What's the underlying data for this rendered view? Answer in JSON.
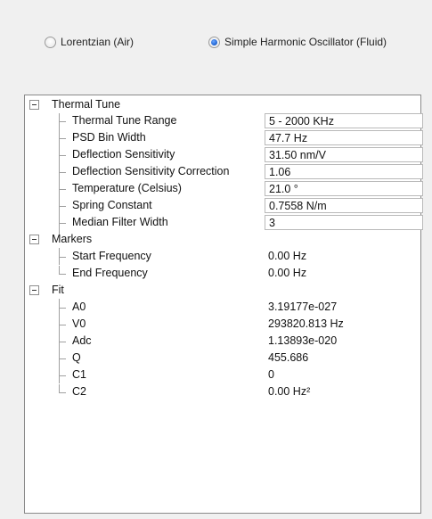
{
  "mode": {
    "options": [
      {
        "label": "Lorentzian (Air)",
        "selected": false
      },
      {
        "label": "Simple Harmonic Oscillator (Fluid)",
        "selected": true
      }
    ]
  },
  "tree": {
    "groups": [
      {
        "label": "Thermal Tune",
        "expanded": true,
        "items": [
          {
            "label": "Thermal Tune Range",
            "value": "5 - 2000 KHz"
          },
          {
            "label": "PSD Bin Width",
            "value": "47.7 Hz"
          },
          {
            "label": "Deflection Sensitivity",
            "value": "31.50 nm/V"
          },
          {
            "label": "Deflection Sensitivity Correction",
            "value": "1.06"
          },
          {
            "label": "Temperature (Celsius)",
            "value": "21.0 °"
          },
          {
            "label": "Spring Constant",
            "value": "0.7558 N/m"
          },
          {
            "label": "Median Filter Width",
            "value": "3"
          }
        ]
      },
      {
        "label": "Markers",
        "expanded": true,
        "items": [
          {
            "label": "Start Frequency",
            "value": "0.00 Hz"
          },
          {
            "label": "End Frequency",
            "value": "0.00 Hz"
          }
        ]
      },
      {
        "label": "Fit",
        "expanded": true,
        "items": [
          {
            "label": "A0",
            "value": "3.19177e-027"
          },
          {
            "label": "V0",
            "value": "293820.813 Hz"
          },
          {
            "label": "Adc",
            "value": "1.13893e-020"
          },
          {
            "label": "Q",
            "value": "455.686"
          },
          {
            "label": "C1",
            "value": "0"
          },
          {
            "label": "C2",
            "value": "0.00 Hz²"
          }
        ]
      }
    ]
  }
}
